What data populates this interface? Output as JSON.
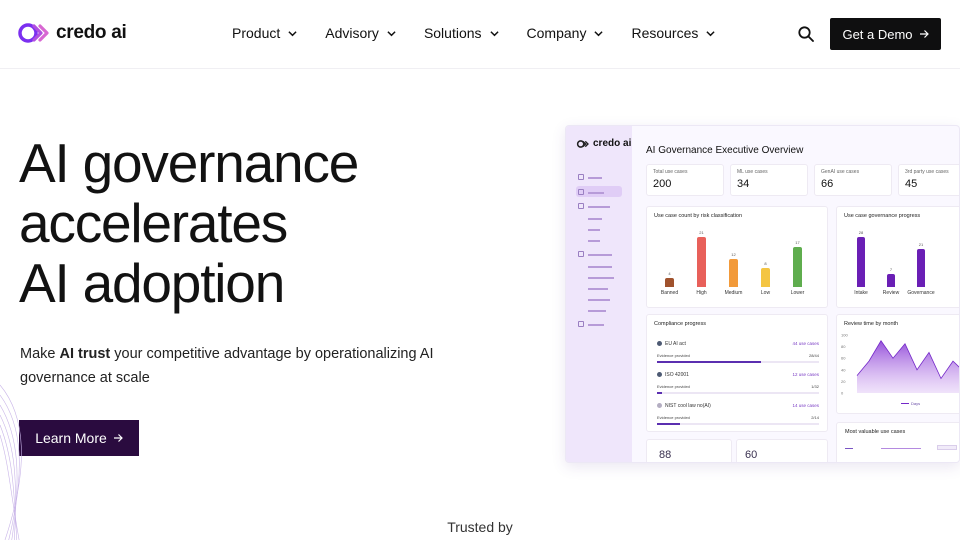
{
  "header": {
    "brand": "credo ai",
    "nav": [
      {
        "label": "Product"
      },
      {
        "label": "Advisory"
      },
      {
        "label": "Solutions"
      },
      {
        "label": "Company"
      },
      {
        "label": "Resources"
      }
    ],
    "search_icon": "search-icon",
    "cta_label": "Get a Demo"
  },
  "hero": {
    "title_lines": [
      "AI governance",
      "accelerates",
      "AI adoption"
    ],
    "subtitle_pre": "Make ",
    "subtitle_bold": "AI trust",
    "subtitle_post": " your competitive advantage by operationalizing AI governance at scale",
    "button_label": "Learn More",
    "trusted_by": "Trusted by"
  },
  "dashboard": {
    "brand": "credo ai",
    "title": "AI Governance Executive Overview",
    "stats": [
      {
        "label": "Total use cases",
        "value": "200"
      },
      {
        "label": "ML use cases",
        "value": "34"
      },
      {
        "label": "GenAI use cases",
        "value": "66"
      },
      {
        "label": "3rd party use cases",
        "value": "45"
      }
    ],
    "risk_chart": {
      "title": "Use case count by risk classification",
      "categories": [
        "Banned",
        "High",
        "Medium",
        "Low",
        "Lower"
      ],
      "values": [
        4,
        21,
        12,
        8,
        17
      ],
      "colors": [
        "#a0522d",
        "#e8605a",
        "#f29a3a",
        "#f4c542",
        "#5fad4e"
      ]
    },
    "progress_chart": {
      "title": "Use case governance progress",
      "categories": [
        "Intake",
        "Review",
        "Governance"
      ],
      "values": [
        28,
        7,
        21
      ],
      "color": "#6a1fb5"
    },
    "compliance": {
      "title": "Compliance progress",
      "items": [
        {
          "name": "EU AI act",
          "link": "44 use cases",
          "evidence": "Evidence provided",
          "fraction": "28/44",
          "progress": 0.64
        },
        {
          "name": "ISO 42001",
          "link": "12 use cases",
          "evidence": "Evidence provided",
          "fraction": "1/32",
          "progress": 0.03
        },
        {
          "name": "NIST cool law no(AI)",
          "link": "14 use cases",
          "evidence": "Evidence provided",
          "fraction": "2/14",
          "progress": 0.14
        }
      ]
    },
    "review_time": {
      "title": "Review time by month",
      "y_ticks": [
        "100",
        "80",
        "60",
        "40",
        "20",
        "0"
      ],
      "values": [
        30,
        55,
        90,
        60,
        85,
        40,
        70,
        25,
        55,
        35
      ],
      "legend": "Days"
    },
    "bottom_values": [
      "88",
      "60"
    ],
    "most_valuable": {
      "title": "Most valuable use cases"
    }
  }
}
